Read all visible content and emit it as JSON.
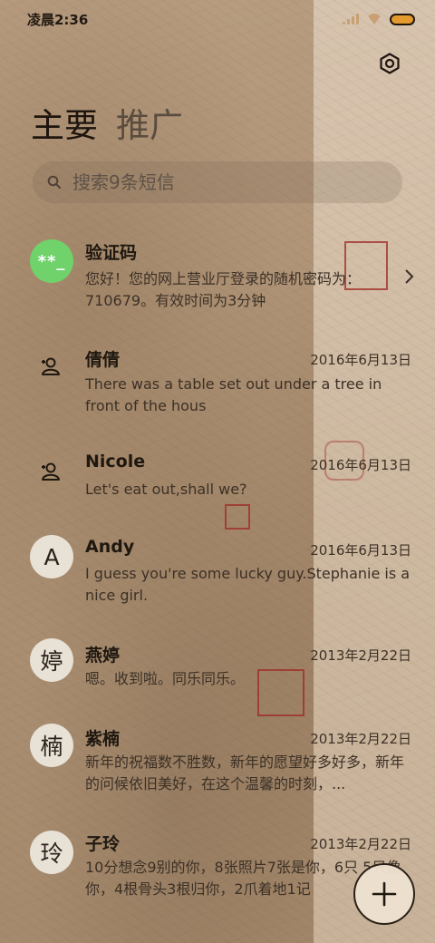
{
  "status_bar": {
    "time": "凌晨2:36"
  },
  "tabs": [
    {
      "label": "主要",
      "active": true
    },
    {
      "label": "推广",
      "active": false
    }
  ],
  "search": {
    "placeholder": "搜索9条短信"
  },
  "conversations": [
    {
      "avatar_type": "code",
      "avatar_text": "**_",
      "name": "验证码",
      "date": "",
      "snippet": "您好！您的网上营业厅登录的随机密码为：710679。有效时间为3分钟",
      "has_chevron": true
    },
    {
      "avatar_type": "contact",
      "avatar_text": "",
      "name": "倩倩",
      "date": "2016年6月13日",
      "snippet": "There was a table set out under a tree in front of the hous"
    },
    {
      "avatar_type": "contact",
      "avatar_text": "",
      "name": "Nicole",
      "date": "2016年6月13日",
      "snippet": "Let's eat out,shall we?"
    },
    {
      "avatar_type": "letter",
      "avatar_text": "A",
      "name": "Andy",
      "date": "2016年6月13日",
      "snippet": "I guess you're some lucky guy.Stephanie is a nice girl."
    },
    {
      "avatar_type": "letter",
      "avatar_text": "婷",
      "name": "燕婷",
      "date": "2013年2月22日",
      "snippet": "嗯。收到啦。同乐同乐。"
    },
    {
      "avatar_type": "letter",
      "avatar_text": "楠",
      "name": "紫楠",
      "date": "2013年2月22日",
      "snippet": "新年的祝福数不胜数，新年的愿望好多好多，新年的问候依旧美好，在这个温馨的时刻，..."
    },
    {
      "avatar_type": "letter",
      "avatar_text": "玲",
      "name": "子玲",
      "date": "2013年2月22日",
      "snippet": "10分想念9别的你，8张照片7张是你，6只 5只像你，4根骨头3根归你，2爪着地1记"
    }
  ],
  "colors": {
    "accent_green": "#6fd26a",
    "seal_red": "#9e2a24",
    "battery": "#e59a2e"
  },
  "icons": {
    "settings": "hexagon-gear-icon",
    "fab": "plus-icon",
    "search": "magnifier-icon",
    "contact": "person-add-icon"
  }
}
